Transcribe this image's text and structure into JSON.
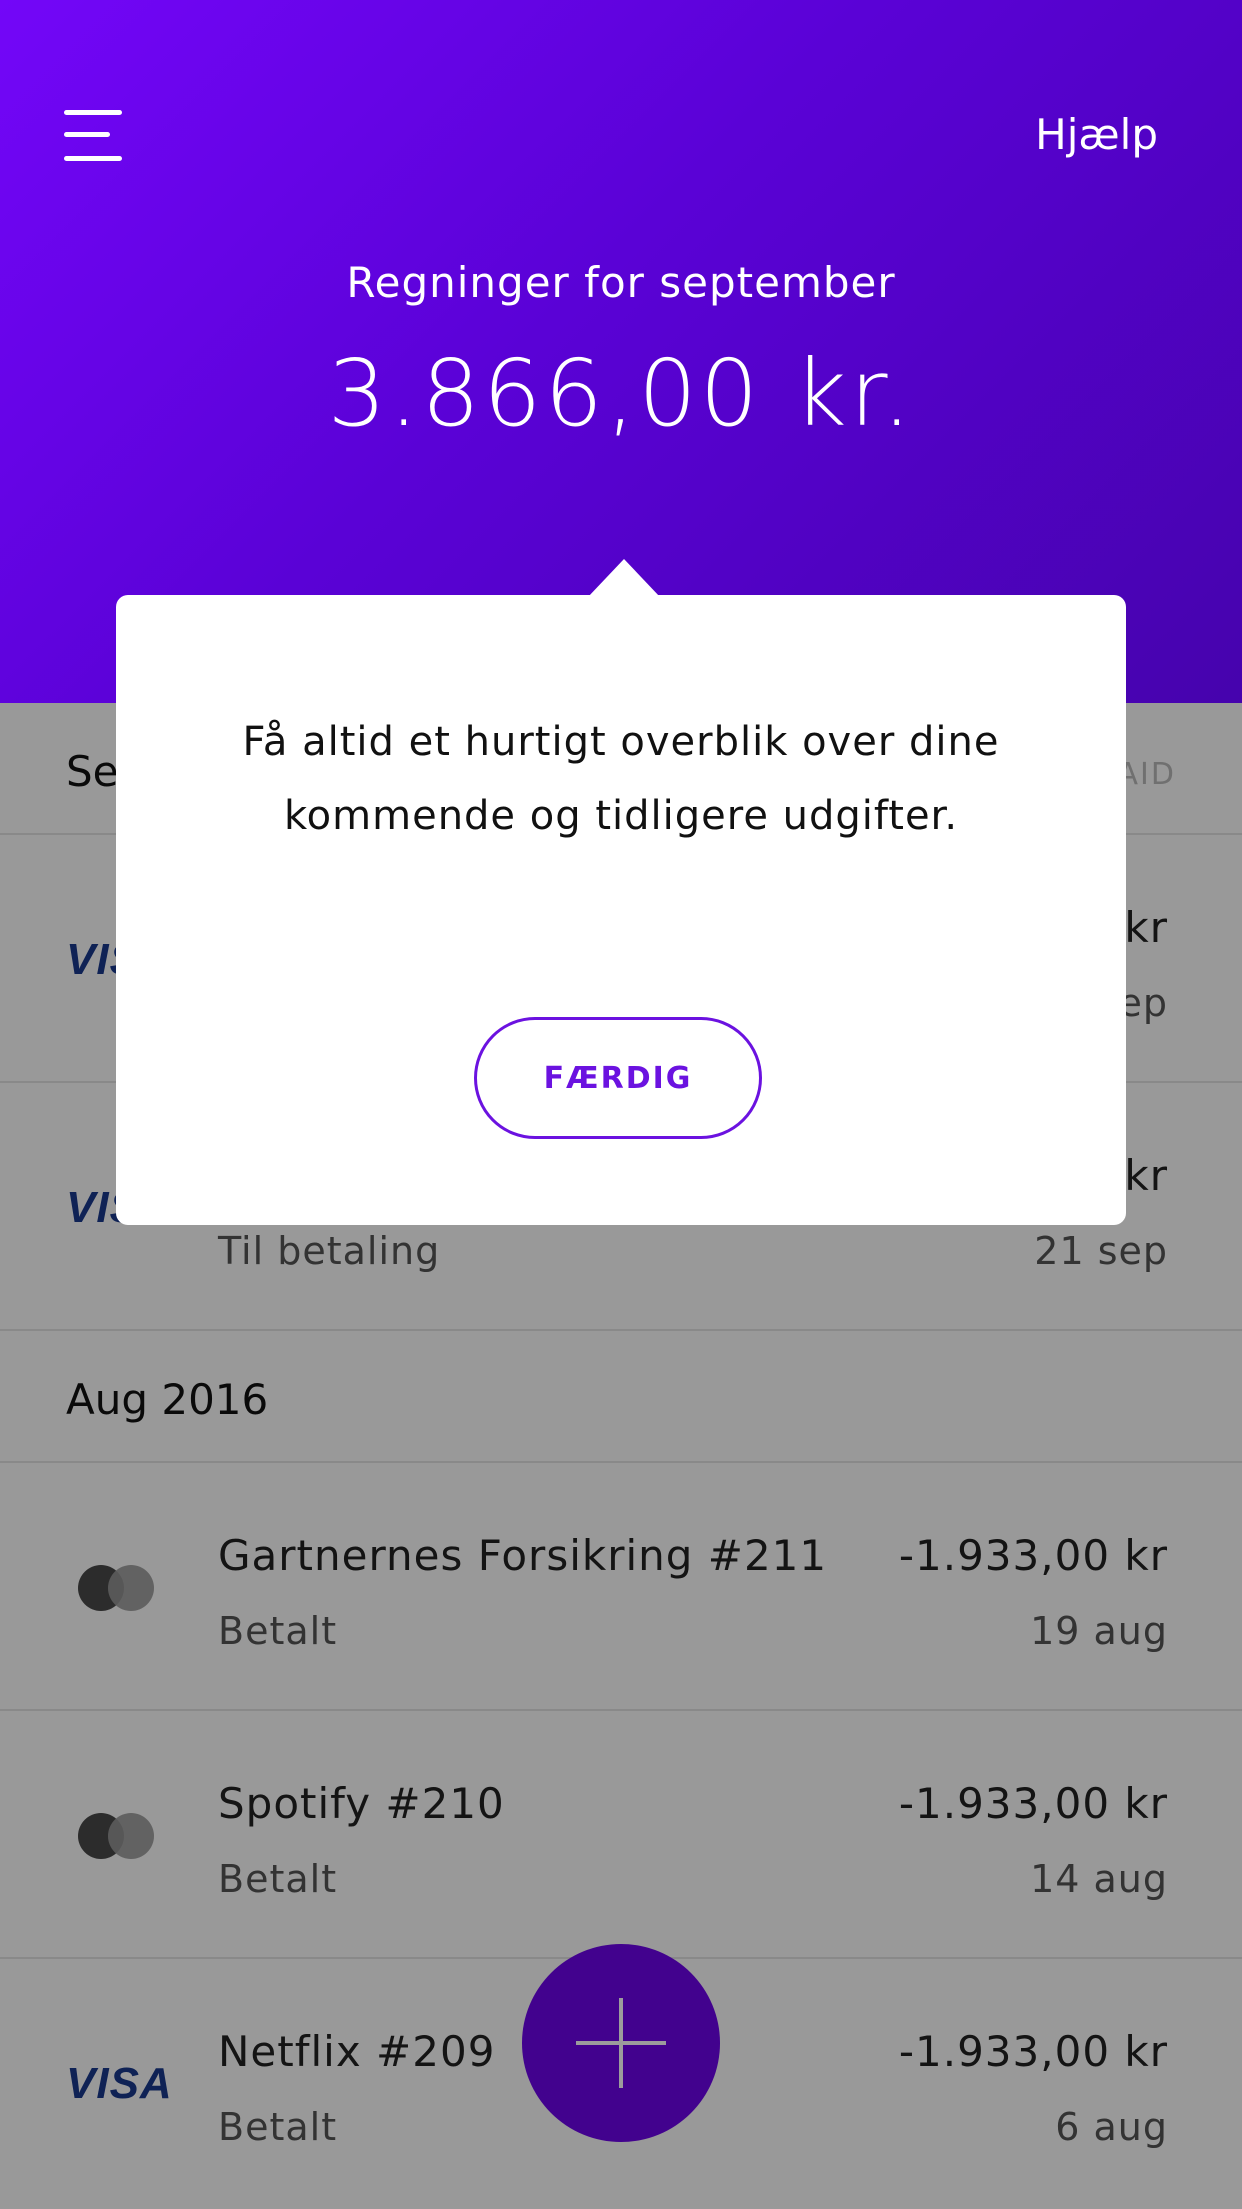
{
  "header": {
    "help_label": "Hjælp",
    "month_title": "Regninger for september",
    "total_amount": "3.866,00 kr."
  },
  "sections": {
    "september": {
      "label": "Se",
      "right_label": "AID"
    },
    "august": {
      "label": "Aug 2016"
    }
  },
  "bills": [
    {
      "logo": "VISA",
      "logo_type": "visa-icon",
      "name": "",
      "status": "",
      "amount": "kr",
      "date": "ep"
    },
    {
      "logo": "VISA",
      "logo_type": "visa-icon",
      "name": "",
      "status": "Til betaling",
      "amount": "kr",
      "date": "21 sep"
    },
    {
      "logo_type": "mastercard-icon",
      "name": "Gartnernes Forsikring #211",
      "status": "Betalt",
      "amount": "-1.933,00 kr",
      "date": "19 aug"
    },
    {
      "logo_type": "mastercard-icon",
      "name": "Spotify #210",
      "status": "Betalt",
      "amount": "-1.933,00 kr",
      "date": "14 aug"
    },
    {
      "logo": "VISA",
      "logo_type": "visa-icon",
      "name": "Netflix #209",
      "status": "Betalt",
      "amount": "-1.933,00 kr",
      "date": "6 aug"
    }
  ],
  "tooltip": {
    "line1": "Få altid et hurtigt overblik over dine",
    "line2": "kommende og tidligere udgifter.",
    "done_label": "FÆRDIG"
  },
  "colors": {
    "header_gradient_start": "#7306f8",
    "header_gradient_end": "#4603ad",
    "accent": "#6b12e0",
    "fab": "#42028e",
    "visa_blue": "#1a3a8e"
  }
}
